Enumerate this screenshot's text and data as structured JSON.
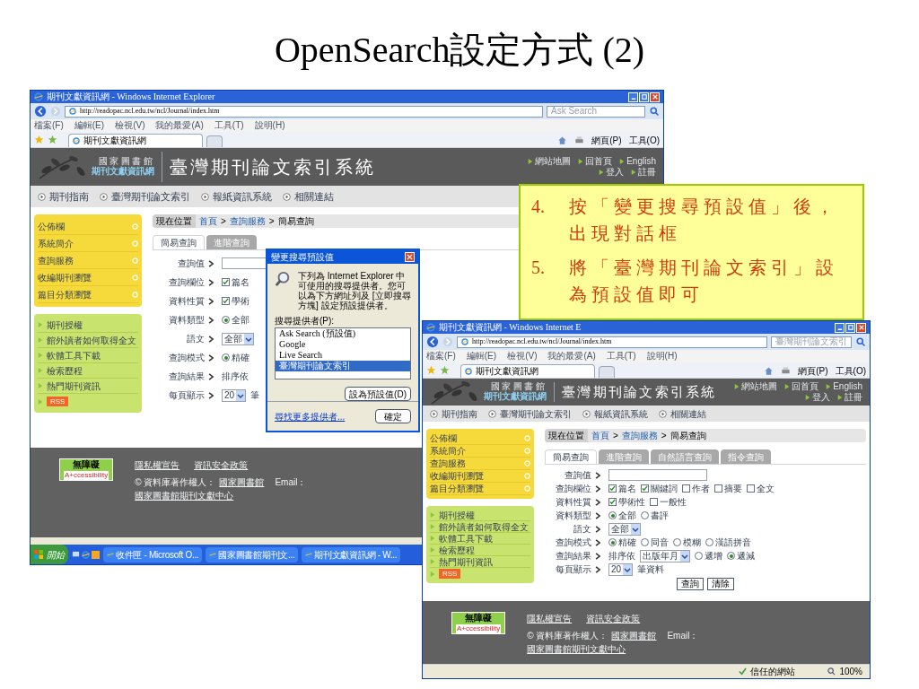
{
  "slide_title": "OpenSearch設定方式 (2)",
  "windows": [
    {
      "title": "期刊文獻資訊網 - Windows Internet Explorer",
      "address": "http://readopac.ncl.edu.tw/ncl/Journal/index.htm",
      "search": "Ask Search",
      "menu": [
        "檔案(F)",
        "編輯(E)",
        "檢視(V)",
        "我的最愛(A)",
        "工具(T)",
        "說明(H)"
      ],
      "tab": "期刊文獻資訊網",
      "toolbar": [
        "網頁(P)",
        "工具(O)"
      ],
      "banner": {
        "org": "國家圖書館",
        "site": "期刊文獻資訊網",
        "system": "臺灣期刊論文索引系統",
        "top_links": [
          "網站地圖",
          "回首頁",
          "English"
        ],
        "user_links": [
          "登入",
          "註冊"
        ]
      },
      "nav": [
        "期刊指南",
        "臺灣期刊論文索引",
        "報紙資訊系統",
        "相關連結"
      ],
      "sidebar": {
        "menu": [
          "公佈欄",
          "系統簡介",
          "查詢服務",
          "收編期刊瀏覽",
          "篇目分類瀏覽"
        ],
        "links": [
          "期刊授權",
          "館外讀者如何取得全文",
          "軟體工具下載",
          "檢索歷程",
          "熱門期刊資訊"
        ],
        "rss": "RSS"
      },
      "breadcrumb": {
        "label": "現在位置",
        "path": [
          {
            "kind": "link",
            "text": "首頁"
          },
          {
            "kind": "sep",
            "text": ">"
          },
          {
            "kind": "link",
            "text": "查詢服務"
          },
          {
            "kind": "sep",
            "text": ">"
          },
          {
            "kind": "text",
            "text": "簡易查詢"
          }
        ]
      },
      "tabs": [
        {
          "label": "簡易查詢",
          "selected": true
        },
        {
          "label": "進階查詢",
          "selected": false
        }
      ],
      "form": [
        {
          "label": "查詢值",
          "controls": [
            {
              "kind": "input"
            }
          ]
        },
        {
          "label": "查詢欄位",
          "controls": [
            {
              "kind": "checkbox",
              "label": "篇名",
              "checked": true
            }
          ]
        },
        {
          "label": "資料性質",
          "controls": [
            {
              "kind": "checkbox",
              "label": "學術",
              "checked": true
            }
          ]
        },
        {
          "label": "資料類型",
          "controls": [
            {
              "kind": "radio",
              "label": "全部",
              "selected": true
            }
          ]
        },
        {
          "label": "語文",
          "controls": [
            {
              "kind": "select",
              "value": "全部"
            }
          ]
        },
        {
          "label": "查詢模式",
          "controls": [
            {
              "kind": "radio",
              "label": "精確",
              "selected": true
            }
          ]
        },
        {
          "label": "查詢結果",
          "controls": [
            {
              "kind": "text",
              "text": "排序依"
            }
          ]
        },
        {
          "label": "每頁顯示",
          "controls": [
            {
              "kind": "select",
              "value": "20"
            },
            {
              "kind": "text",
              "text": "筆"
            }
          ]
        }
      ],
      "footer": {
        "badge": [
          "無障礙",
          "A+ccessibility"
        ],
        "links": [
          "隱私權宣告",
          "資訊安全政策"
        ],
        "credits": [
          {
            "kind": "text",
            "text": "© 資料庫著作權人："
          },
          {
            "kind": "link",
            "text": "國家圖書館"
          },
          {
            "kind": "text",
            "text": "Email："
          },
          {
            "kind": "link",
            "text": "國家圖書館期刊文獻中心"
          }
        ]
      },
      "dialog": {
        "title": "變更搜尋預設值",
        "message": "下列為 Internet Explorer 中可使用的搜尋提供者。您可以為下方網址列及 [立即搜尋方塊] 設定預設提供者。",
        "list_label": "搜尋提供者(P):",
        "providers": [
          {
            "label": "Ask Search (預設值)",
            "selected": false
          },
          {
            "label": "Google",
            "selected": false
          },
          {
            "label": "Live Search",
            "selected": false
          },
          {
            "label": "臺灣期刊論文索引",
            "selected": true
          }
        ],
        "set_default": "設為預設值(D)",
        "more_link": "尋找更多提供者...",
        "ok": "確定"
      },
      "taskbar": {
        "start": "開始",
        "items": [
          "收件匣 - Microsoft O...",
          "國家圖書館期刊文...",
          "期刊文獻資訊網 - W..."
        ]
      }
    },
    {
      "title": "期刊文獻資訊網 - Windows Internet E",
      "address": "http://readopac.ncl.edu.tw/ncl/Journal/index.htm",
      "search": "臺灣期刊論文索引",
      "menu": [
        "檔案(F)",
        "編輯(E)",
        "檢視(V)",
        "我的最愛(A)",
        "工具(T)",
        "說明(H)"
      ],
      "tab": "期刊文獻資訊網",
      "toolbar": [
        "網頁(P)",
        "工具(O)"
      ],
      "banner": {
        "org": "國家圖書館",
        "site": "期刊文獻資訊網",
        "system": "臺灣期刊論文索引系統",
        "top_links": [
          "網站地圖",
          "回首頁",
          "English"
        ],
        "user_links": [
          "登入",
          "註冊"
        ]
      },
      "nav": [
        "期刊指南",
        "臺灣期刊論文索引",
        "報紙資訊系統",
        "相關連結"
      ],
      "sidebar": {
        "menu": [
          "公佈欄",
          "系統簡介",
          "查詢服務",
          "收編期刊瀏覽",
          "篇目分類瀏覽"
        ],
        "links": [
          "期刊授權",
          "館外讀者如何取得全文",
          "軟體工具下載",
          "檢索歷程",
          "熱門期刊資訊"
        ],
        "rss": "RSS"
      },
      "breadcrumb": {
        "label": "現在位置",
        "path": [
          {
            "kind": "link",
            "text": "首頁"
          },
          {
            "kind": "sep",
            "text": ">"
          },
          {
            "kind": "link",
            "text": "查詢服務"
          },
          {
            "kind": "sep",
            "text": ">"
          },
          {
            "kind": "text",
            "text": "簡易查詢"
          }
        ]
      },
      "tabs": [
        {
          "label": "簡易查詢",
          "selected": true
        },
        {
          "label": "進階查詢",
          "selected": false
        },
        {
          "label": "自然語言查詢",
          "selected": false
        },
        {
          "label": "指令查詢",
          "selected": false
        }
      ],
      "form": [
        {
          "label": "查詢值",
          "controls": [
            {
              "kind": "input"
            }
          ]
        },
        {
          "label": "查詢欄位",
          "controls": [
            {
              "kind": "checkbox",
              "label": "篇名",
              "checked": true
            },
            {
              "kind": "checkbox",
              "label": "關鍵詞",
              "checked": true
            },
            {
              "kind": "checkbox",
              "label": "作者",
              "checked": false
            },
            {
              "kind": "checkbox",
              "label": "摘要",
              "checked": false
            },
            {
              "kind": "checkbox",
              "label": "全文",
              "checked": false
            }
          ]
        },
        {
          "label": "資料性質",
          "controls": [
            {
              "kind": "checkbox",
              "label": "學術性",
              "checked": true
            },
            {
              "kind": "checkbox",
              "label": "一般性",
              "checked": false
            }
          ]
        },
        {
          "label": "資料類型",
          "controls": [
            {
              "kind": "radio",
              "label": "全部",
              "selected": true
            },
            {
              "kind": "radio",
              "label": "書評",
              "selected": false
            }
          ]
        },
        {
          "label": "語文",
          "controls": [
            {
              "kind": "select",
              "value": "全部"
            }
          ]
        },
        {
          "label": "查詢模式",
          "controls": [
            {
              "kind": "radio",
              "label": "精確",
              "selected": true
            },
            {
              "kind": "radio",
              "label": "同音",
              "selected": false
            },
            {
              "kind": "radio",
              "label": "模糊",
              "selected": false
            },
            {
              "kind": "radio",
              "label": "漢語拼音",
              "selected": false
            }
          ]
        },
        {
          "label": "查詢結果",
          "controls": [
            {
              "kind": "text",
              "text": "排序依"
            },
            {
              "kind": "select",
              "value": "出版年月"
            },
            {
              "kind": "radio",
              "label": "遞增",
              "selected": false
            },
            {
              "kind": "radio",
              "label": "遞減",
              "selected": true
            }
          ]
        },
        {
          "label": "每頁顯示",
          "controls": [
            {
              "kind": "select",
              "value": "20"
            },
            {
              "kind": "text",
              "text": "筆資料"
            }
          ]
        }
      ],
      "buttons": [
        "查詢",
        "清除"
      ],
      "footer": {
        "badge": [
          "無障礙",
          "A+ccessibility"
        ],
        "links": [
          "隱私權宣告",
          "資訊安全政策"
        ],
        "credits": [
          {
            "kind": "text",
            "text": "© 資料庫著作權人："
          },
          {
            "kind": "link",
            "text": "國家圖書館"
          },
          {
            "kind": "text",
            "text": "Email："
          },
          {
            "kind": "link",
            "text": "國家圖書館期刊文獻中心"
          }
        ]
      },
      "status": {
        "zone": "信任的網站",
        "zoom": "100%"
      }
    }
  ],
  "callout": {
    "items": [
      {
        "number": "4.",
        "text": "按「變更搜尋預設值」後，出現對話框"
      },
      {
        "number": "5.",
        "text": "將「臺灣期刊論文索引」設為預設值即可"
      }
    ]
  }
}
